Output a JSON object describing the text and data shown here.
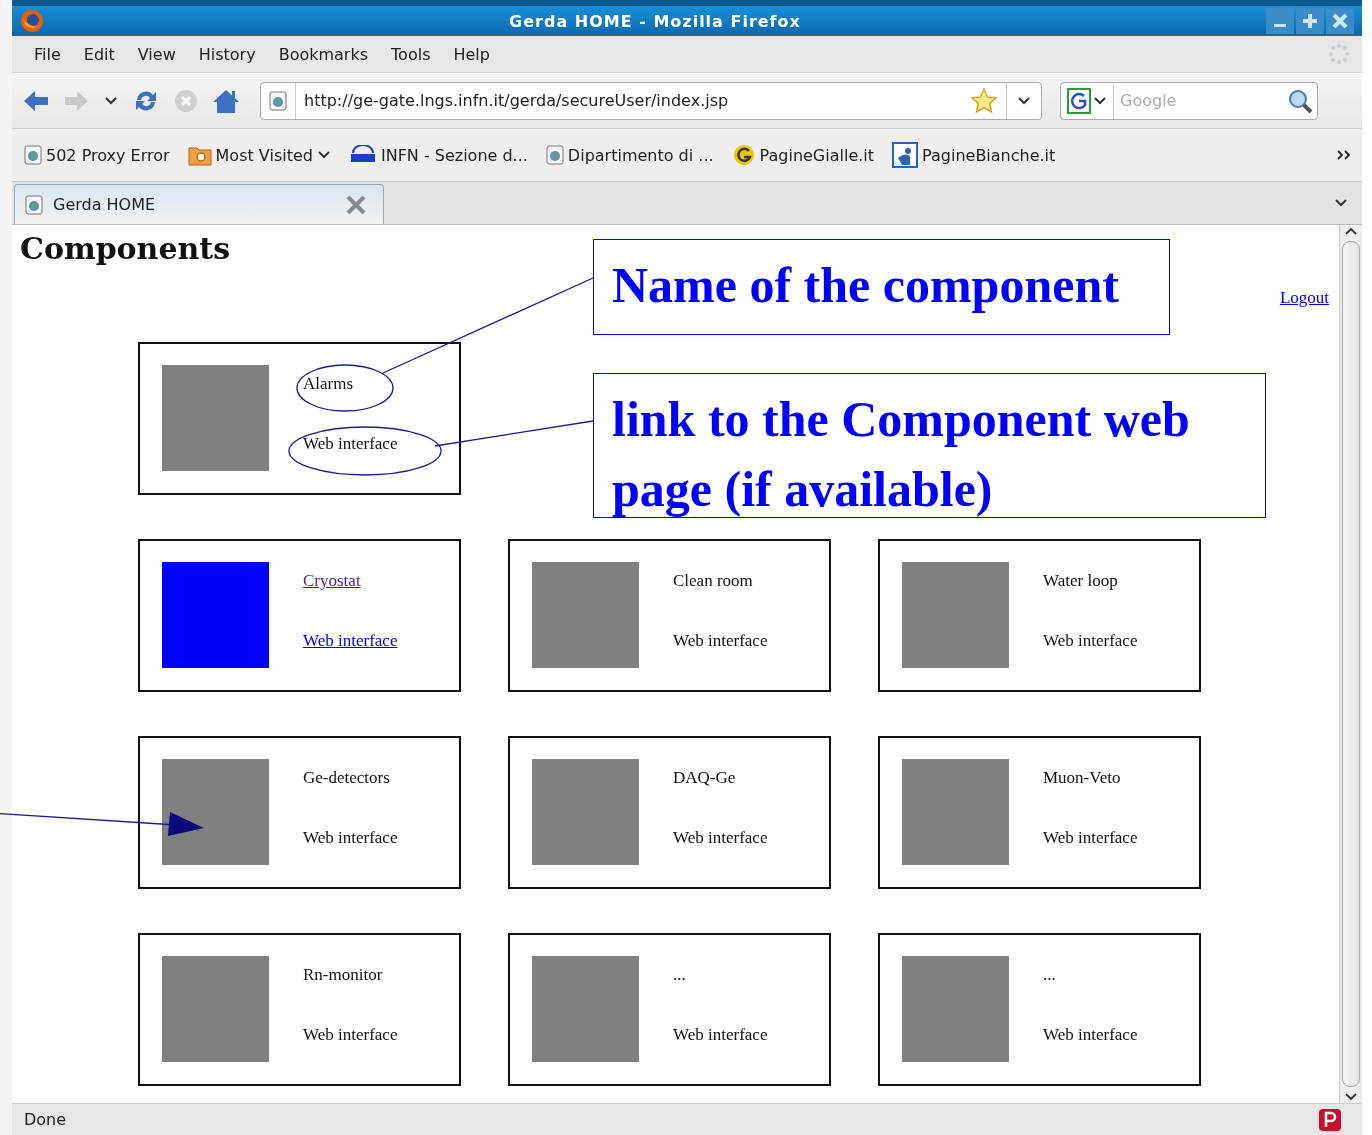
{
  "window": {
    "title": "Gerda HOME - Mozilla Firefox"
  },
  "menu": [
    "File",
    "Edit",
    "View",
    "History",
    "Bookmarks",
    "Tools",
    "Help"
  ],
  "address": {
    "value": "http://ge-gate.lngs.infn.it/gerda/secureUser/index.jsp"
  },
  "search": {
    "placeholder": "Google"
  },
  "bookmarks": [
    {
      "label": "502 Proxy Error",
      "kind": "page"
    },
    {
      "label": "Most Visited",
      "kind": "folder"
    },
    {
      "label": "INFN - Sezione d...",
      "kind": "infn"
    },
    {
      "label": "Dipartimento di ...",
      "kind": "page"
    },
    {
      "label": "PagineGialle.it",
      "kind": "gialle"
    },
    {
      "label": "PagineBianche.it",
      "kind": "bianche"
    }
  ],
  "tabs": [
    {
      "label": "Gerda HOME",
      "selected": true
    }
  ],
  "page": {
    "heading": "Components",
    "logout": "Logout",
    "components": [
      {
        "name": "Alarms",
        "link": "Web interface",
        "linked": false,
        "color": "#808080"
      },
      {
        "name": "Cryostat",
        "link": "Web interface",
        "linked": true,
        "color": "#0000ff"
      },
      {
        "name": "Clean room",
        "link": "Web interface",
        "linked": false,
        "color": "#808080"
      },
      {
        "name": "Water loop",
        "link": "Web interface",
        "linked": false,
        "color": "#808080"
      },
      {
        "name": "Ge-detectors",
        "link": "Web interface",
        "linked": false,
        "color": "#808080"
      },
      {
        "name": "DAQ-Ge",
        "link": "Web interface",
        "linked": false,
        "color": "#808080"
      },
      {
        "name": "Muon-Veto",
        "link": "Web interface",
        "linked": false,
        "color": "#808080"
      },
      {
        "name": "Rn-monitor",
        "link": "Web interface",
        "linked": false,
        "color": "#808080"
      },
      {
        "name": "...",
        "link": "Web interface",
        "linked": false,
        "color": "#808080"
      },
      {
        "name": "...",
        "link": "Web interface",
        "linked": false,
        "color": "#808080"
      }
    ]
  },
  "callouts": [
    "Name of the component",
    "link to the Component web page (if available)"
  ],
  "status_bar": "Done"
}
